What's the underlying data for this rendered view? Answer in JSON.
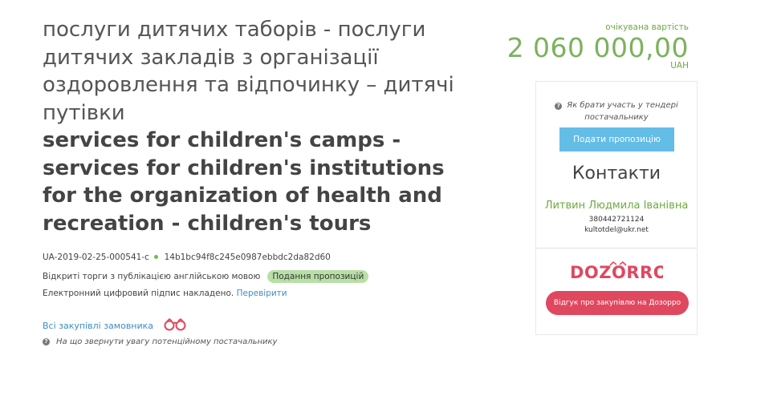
{
  "tender": {
    "title_uk": "послуги дитячих таборів - послуги дитячих закладів з організації оздоровлення та відпочинку – дитячі путівки",
    "title_en": "services for children's camps - services for children's institutions for the organization of health and recreation - children's tours",
    "id": "UA-2019-02-25-000541-c",
    "hash": "14b1bc94f8c245e0987ebbdc2da82d60",
    "procedure_type": "Відкриті торги з публікацією англійською мовою",
    "status_badge": "Подання пропозицій",
    "signature_text": "Електронний цифровий підпис накладено.",
    "verify_link": "Перевірити",
    "all_purchases_link": "Всі закупівлі замовника",
    "supplier_hint": "На що звернути увагу потенційному постачальнику"
  },
  "price": {
    "label": "очікувана вартість",
    "amount": "2 060 000,00",
    "currency": "UAH"
  },
  "sidebar": {
    "how_to_participate": "Як брати участь у тендері постачальнику",
    "submit_button": "Подати пропозицію",
    "contacts_title": "Контакти",
    "contact_name": "Литвин Людмила Іванівна",
    "contact_phone": "380442721124",
    "contact_email": "kultotdel@ukr.net",
    "review_button": "Відгук про закупівлю на Дозорро"
  },
  "colors": {
    "accent_green": "#7bb25c",
    "button_blue": "#63bde6",
    "dozorro_red": "#e0485f",
    "badge_green": "#b8e0a6",
    "link_blue": "#3b8ec2"
  },
  "icons": {
    "question": "question-circle-icon",
    "binoculars": "binoculars-icon",
    "dozorro": "dozorro-logo"
  }
}
